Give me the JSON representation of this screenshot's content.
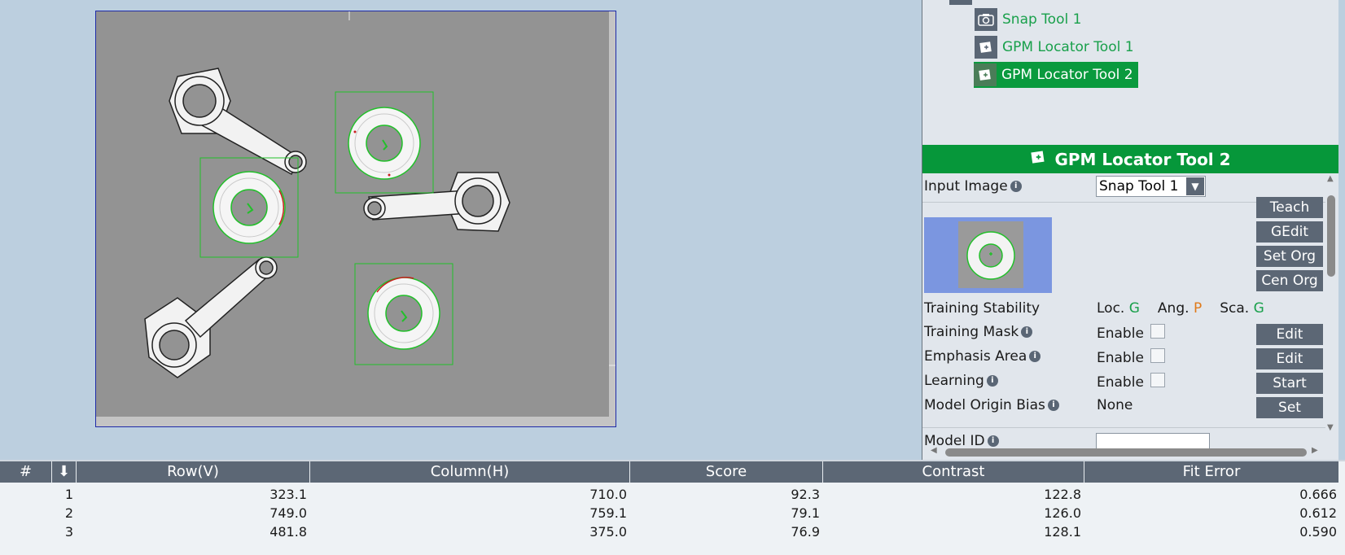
{
  "tree": {
    "items": [
      {
        "label": "Snap Tool 1",
        "icon": "camera-icon"
      },
      {
        "label": "GPM Locator Tool 1",
        "icon": "locator-icon"
      },
      {
        "label": "GPM Locator Tool 2",
        "icon": "locator-icon",
        "selected": true
      }
    ]
  },
  "props": {
    "title": "GPM Locator Tool 2",
    "input_image_label": "Input Image",
    "input_image_value": "Snap Tool 1",
    "buttons": [
      "Teach",
      "GEdit",
      "Set Org",
      "Cen Org"
    ],
    "training_stability_label": "Training Stability",
    "stability": {
      "loc_label": "Loc.",
      "loc_value": "G",
      "ang_label": "Ang.",
      "ang_value": "P",
      "sca_label": "Sca.",
      "sca_value": "G"
    },
    "training_mask_label": "Training Mask",
    "emphasis_area_label": "Emphasis Area",
    "learning_label": "Learning",
    "enable_label": "Enable",
    "edit_label": "Edit",
    "start_label": "Start",
    "model_origin_bias_label": "Model Origin Bias",
    "model_origin_bias_value": "None",
    "set_label": "Set",
    "model_id_label": "Model ID",
    "colors": {
      "good": "#19a04b",
      "poor": "#e07a1a",
      "accent": "#06973a"
    }
  },
  "results": {
    "headers": [
      "#",
      "Row(V)",
      "Column(H)",
      "Score",
      "Contrast",
      "Fit Error"
    ],
    "rows": [
      {
        "n": "1",
        "row": "323.1",
        "col": "710.0",
        "score": "92.3",
        "contrast": "122.8",
        "fit": "0.666"
      },
      {
        "n": "2",
        "row": "749.0",
        "col": "759.1",
        "score": "79.1",
        "contrast": "126.0",
        "fit": "0.612"
      },
      {
        "n": "3",
        "row": "481.8",
        "col": "375.0",
        "score": "76.9",
        "contrast": "128.1",
        "fit": "0.590"
      }
    ]
  }
}
